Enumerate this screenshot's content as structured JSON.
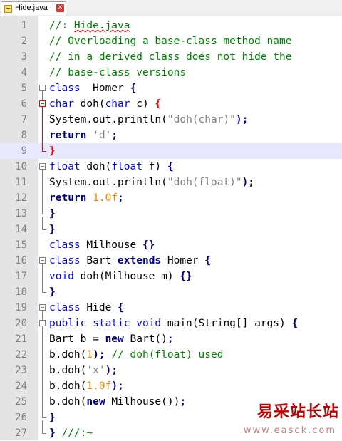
{
  "tab": {
    "label": "Hide.java",
    "close_glyph": "✕"
  },
  "watermark": {
    "title": "易采站长站",
    "url": "www.easck.com"
  },
  "current_line": 9,
  "lines": [
    {
      "n": "1",
      "tokens": [
        [
          "cm",
          "//: "
        ],
        [
          "cm squig",
          "Hide.java"
        ]
      ]
    },
    {
      "n": "2",
      "tokens": [
        [
          "cm",
          "// Overloading a base-class method name"
        ]
      ]
    },
    {
      "n": "3",
      "tokens": [
        [
          "cm",
          "// in a derived class does not hide the"
        ]
      ]
    },
    {
      "n": "4",
      "tokens": [
        [
          "cm",
          "// base-class versions"
        ]
      ]
    },
    {
      "n": "5",
      "tokens": [
        [
          "kw",
          "class"
        ],
        [
          "",
          "  Homer "
        ],
        [
          "op",
          "{"
        ]
      ]
    },
    {
      "n": "6",
      "tokens": [
        [
          "kw",
          "char"
        ],
        [
          "",
          " doh("
        ],
        [
          "kw",
          "char"
        ],
        [
          "",
          " c) "
        ],
        [
          "redbrace",
          "{"
        ]
      ]
    },
    {
      "n": "7",
      "tokens": [
        [
          "",
          "System.out.println("
        ],
        [
          "st",
          "\"doh(char)\""
        ],
        [
          "op",
          ");"
        ]
      ]
    },
    {
      "n": "8",
      "tokens": [
        [
          "kwb",
          "return"
        ],
        [
          "",
          " "
        ],
        [
          "st",
          "'d'"
        ],
        [
          "op",
          ";"
        ]
      ]
    },
    {
      "n": "9",
      "tokens": [
        [
          "redbrace",
          "}"
        ]
      ]
    },
    {
      "n": "10",
      "tokens": [
        [
          "kw",
          "float"
        ],
        [
          "",
          " doh("
        ],
        [
          "kw",
          "float"
        ],
        [
          "",
          " f) "
        ],
        [
          "op",
          "{"
        ]
      ]
    },
    {
      "n": "11",
      "tokens": [
        [
          "",
          "System.out.println("
        ],
        [
          "st",
          "\"doh(float)\""
        ],
        [
          "op",
          ");"
        ]
      ]
    },
    {
      "n": "12",
      "tokens": [
        [
          "kwb",
          "return"
        ],
        [
          "",
          " "
        ],
        [
          "nu",
          "1.0f"
        ],
        [
          "op",
          ";"
        ]
      ]
    },
    {
      "n": "13",
      "tokens": [
        [
          "op",
          "}"
        ]
      ]
    },
    {
      "n": "14",
      "tokens": [
        [
          "op",
          "}"
        ]
      ]
    },
    {
      "n": "15",
      "tokens": [
        [
          "kw",
          "class"
        ],
        [
          "",
          " Milhouse "
        ],
        [
          "op",
          "{}"
        ]
      ]
    },
    {
      "n": "16",
      "tokens": [
        [
          "kw",
          "class"
        ],
        [
          "",
          " Bart "
        ],
        [
          "kwb",
          "extends"
        ],
        [
          "",
          " Homer "
        ],
        [
          "op",
          "{"
        ]
      ]
    },
    {
      "n": "17",
      "tokens": [
        [
          "kw",
          "void"
        ],
        [
          "",
          " doh(Milhouse m) "
        ],
        [
          "op",
          "{}"
        ]
      ]
    },
    {
      "n": "18",
      "tokens": [
        [
          "op",
          "}"
        ]
      ]
    },
    {
      "n": "19",
      "tokens": [
        [
          "kw",
          "class"
        ],
        [
          "",
          " Hide "
        ],
        [
          "op",
          "{"
        ]
      ]
    },
    {
      "n": "20",
      "tokens": [
        [
          "kw",
          "public static void"
        ],
        [
          "",
          " main(String[] args) "
        ],
        [
          "op",
          "{"
        ]
      ]
    },
    {
      "n": "21",
      "tokens": [
        [
          "",
          "Bart b = "
        ],
        [
          "kwb",
          "new"
        ],
        [
          "",
          " Bart()"
        ],
        [
          "op",
          ";"
        ]
      ]
    },
    {
      "n": "22",
      "tokens": [
        [
          "",
          "b.doh("
        ],
        [
          "nu",
          "1"
        ],
        [
          "op",
          ");"
        ],
        [
          "cm",
          " // doh(float) used"
        ]
      ]
    },
    {
      "n": "23",
      "tokens": [
        [
          "",
          "b.doh("
        ],
        [
          "st",
          "'x'"
        ],
        [
          "op",
          ");"
        ]
      ]
    },
    {
      "n": "24",
      "tokens": [
        [
          "",
          "b.doh("
        ],
        [
          "nu",
          "1.0f"
        ],
        [
          "op",
          ");"
        ]
      ]
    },
    {
      "n": "25",
      "tokens": [
        [
          "",
          "b.doh("
        ],
        [
          "kwb",
          "new"
        ],
        [
          "",
          " Milhouse())"
        ],
        [
          "op",
          ";"
        ]
      ]
    },
    {
      "n": "26",
      "tokens": [
        [
          "op",
          "}"
        ]
      ]
    },
    {
      "n": "27",
      "tokens": [
        [
          "op",
          "}"
        ],
        [
          "cm",
          " ///:~"
        ]
      ]
    }
  ]
}
